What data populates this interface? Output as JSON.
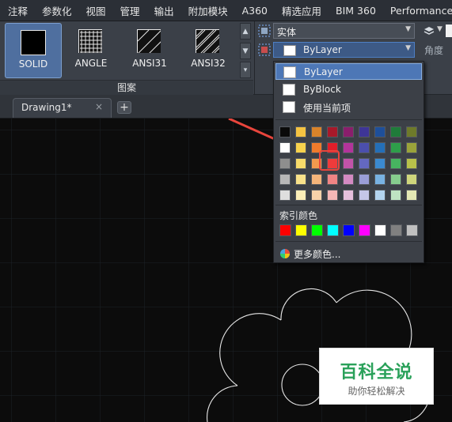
{
  "menu": {
    "items": [
      "注释",
      "参数化",
      "视图",
      "管理",
      "输出",
      "附加模块",
      "A360",
      "精选应用",
      "BIM 360",
      "Performance"
    ]
  },
  "hatch_panel": {
    "patterns": [
      {
        "label": "SOLID",
        "active": true
      },
      {
        "label": "ANGLE",
        "active": false
      },
      {
        "label": "ANSI31",
        "active": false
      },
      {
        "label": "ANSI32",
        "active": false
      }
    ],
    "footer_label": "图案"
  },
  "properties": {
    "linetype_value": "实体",
    "color_value": "ByLayer",
    "angle_label": "角度"
  },
  "tabs": {
    "document_tab": "Drawing1*",
    "close_glyph": "×",
    "new_tab_glyph": "+"
  },
  "color_dropdown": {
    "options": [
      {
        "label": "ByLayer",
        "selected": true
      },
      {
        "label": "ByBlock",
        "selected": false
      },
      {
        "label": "使用当前项",
        "selected": false
      }
    ],
    "palette_rows": [
      [
        "#0a0a0a",
        "#f5c342",
        "#d9832a",
        "#a8192a",
        "#8a1e6c",
        "#3e3597",
        "#1e4f9a",
        "#1f7c3a",
        "#6e7a2a"
      ],
      [
        "#ffffff",
        "#f7d24d",
        "#f07b2c",
        "#e01e2a",
        "#b2349b",
        "#4b4fae",
        "#246fb8",
        "#2e9e4a",
        "#9aa33a"
      ],
      [
        "#8e8e8e",
        "#f6da6a",
        "#f39a4e",
        "#ee3b3b",
        "#c253a8",
        "#6468c0",
        "#3b8ad0",
        "#47b460",
        "#b8c04a"
      ],
      [
        "#b7b7b7",
        "#f8e18a",
        "#f4b47a",
        "#f08484",
        "#d48ac2",
        "#9a9ed8",
        "#78b2e2",
        "#86cc8e",
        "#cfd67c"
      ],
      [
        "#dedede",
        "#fbeeb8",
        "#f8d2aa",
        "#f5b6b6",
        "#e6bfdc",
        "#c5c7e8",
        "#b3d4ef",
        "#bfe3c2",
        "#e3e8b4"
      ]
    ],
    "index_label": "索引颜色",
    "index_colors": [
      "#ff0000",
      "#ffff00",
      "#00ff00",
      "#00ffff",
      "#0000ff",
      "#ff00ff",
      "#ffffff",
      "#808080",
      "#c0c0c0"
    ],
    "more_colors_label": "更多颜色..."
  },
  "watermark": {
    "title": "百科全说",
    "subtitle": "助你轻松解决"
  },
  "colors": {
    "accent": "#4d77b6",
    "annotation_arrow": "#e8453c",
    "canvas_background": "#0c0c0c",
    "drawing_line": "#e6e6e6"
  }
}
